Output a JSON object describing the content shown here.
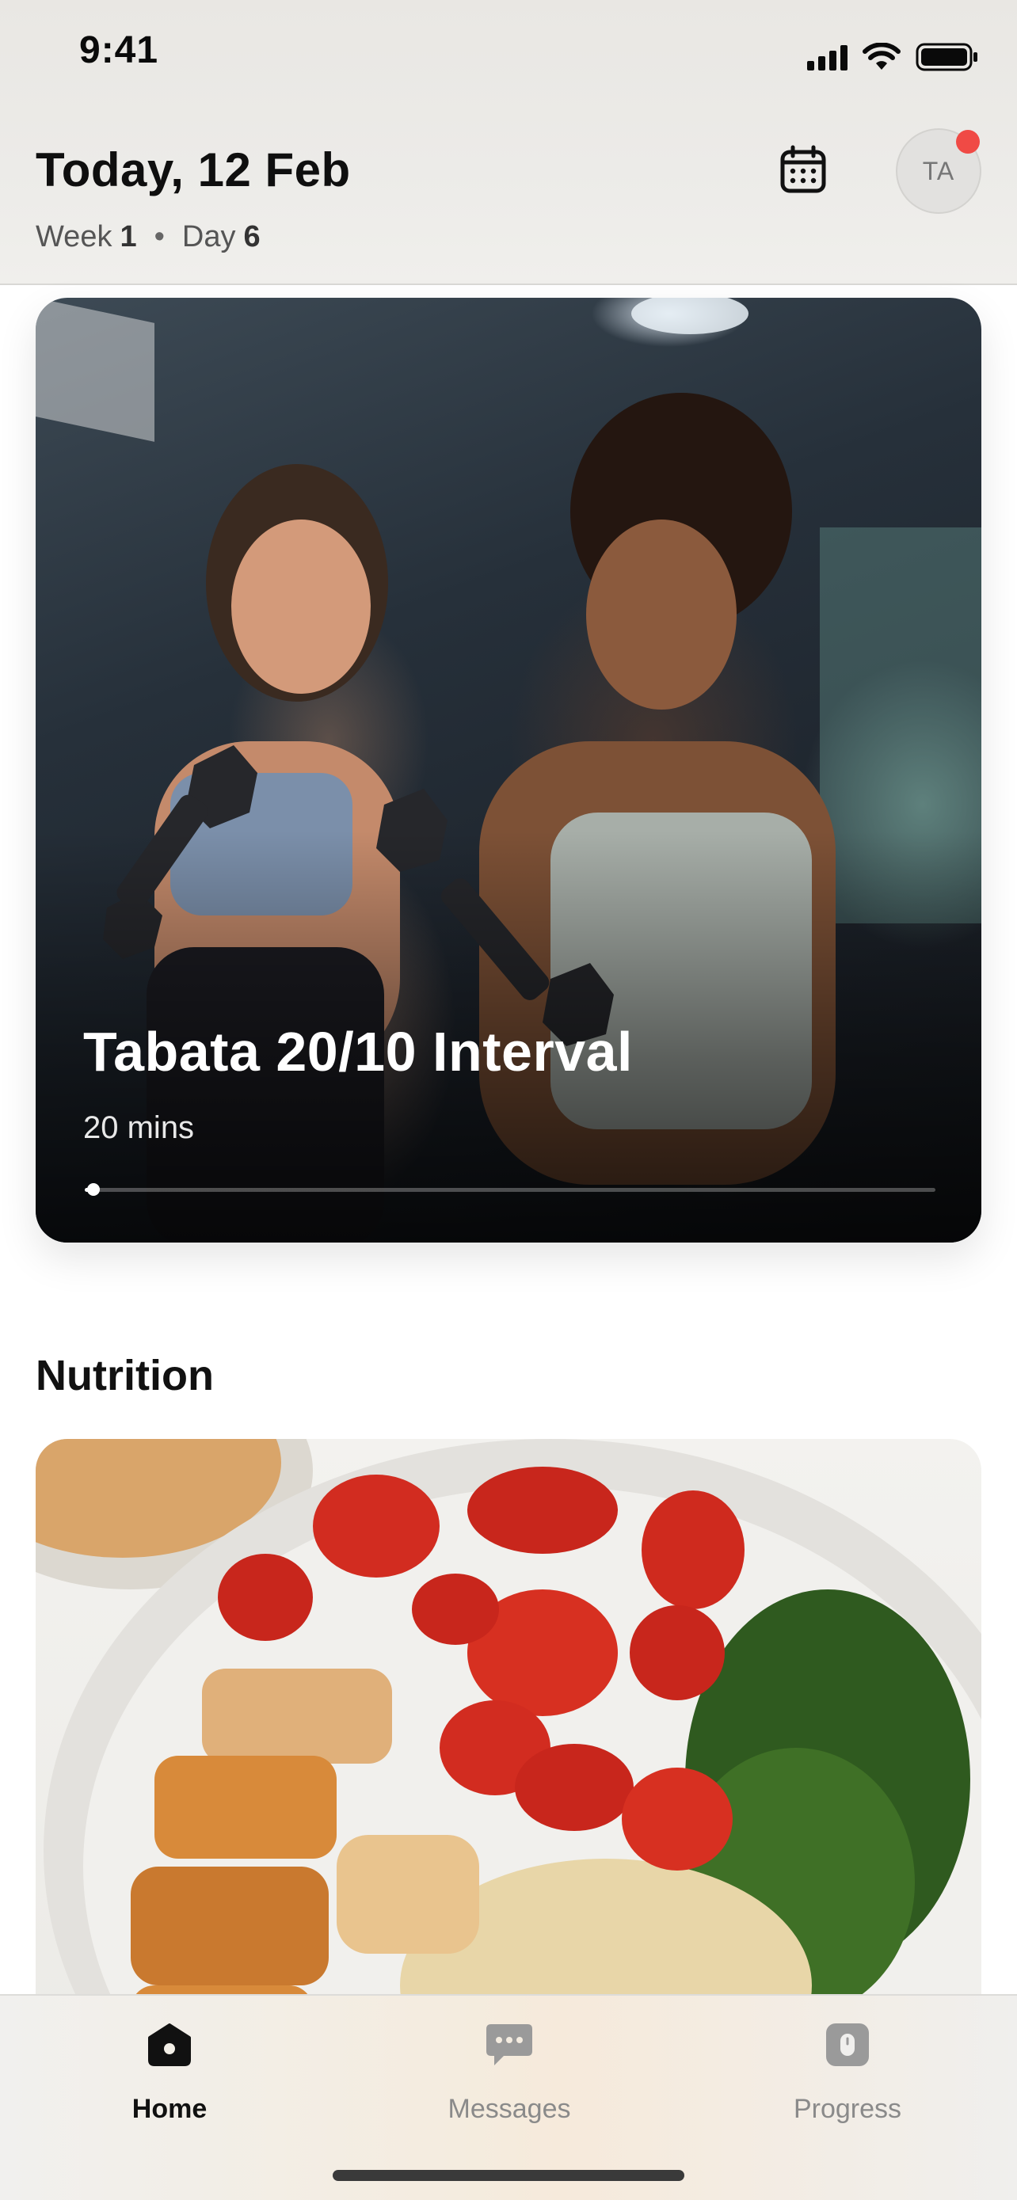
{
  "status_bar": {
    "time": "9:41"
  },
  "header": {
    "date_title": "Today, 12 Feb",
    "week_label": "Week",
    "week_value": "1",
    "day_label": "Day",
    "day_value": "6",
    "avatar_initials": "TA",
    "notification_color": "#f04a45"
  },
  "workout": {
    "title": "Tabata 20/10 Interval",
    "duration": "20 mins",
    "progress": 0.01
  },
  "nutrition": {
    "section_title": "Nutrition"
  },
  "tab_bar": {
    "tabs": [
      {
        "label": "Home",
        "icon": "home-icon",
        "active": true
      },
      {
        "label": "Messages",
        "icon": "chat-icon",
        "active": false
      },
      {
        "label": "Progress",
        "icon": "progress-icon",
        "active": false
      }
    ]
  }
}
